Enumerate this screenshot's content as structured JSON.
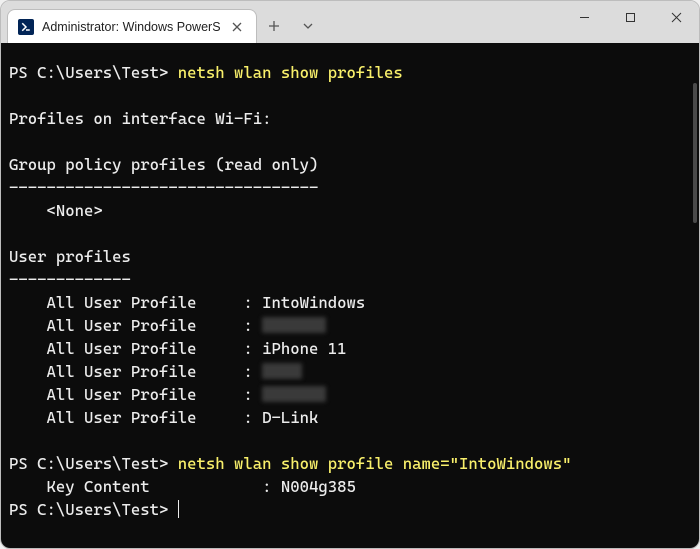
{
  "window": {
    "tab_title": "Administrator: Windows PowerS",
    "icon_name": "powershell-icon"
  },
  "terminal": {
    "prompt": "PS C:\\Users\\Test>",
    "cmd1": "netsh wlan show profiles",
    "out": {
      "header": "Profiles on interface Wi-Fi:",
      "gp_header": "Group policy profiles (read only)",
      "gp_rule": "---------------------------------",
      "gp_none": "    <None>",
      "up_header": "User profiles",
      "up_rule": "-------------",
      "row_label": "    All User Profile     : ",
      "profiles": [
        "IntoWindows",
        "",
        "iPhone 11",
        "",
        "",
        "D-Link"
      ]
    },
    "cmd2": "netsh wlan show profile name=\"IntoWindows\"",
    "key_line": "    Key Content            : N004g385"
  }
}
